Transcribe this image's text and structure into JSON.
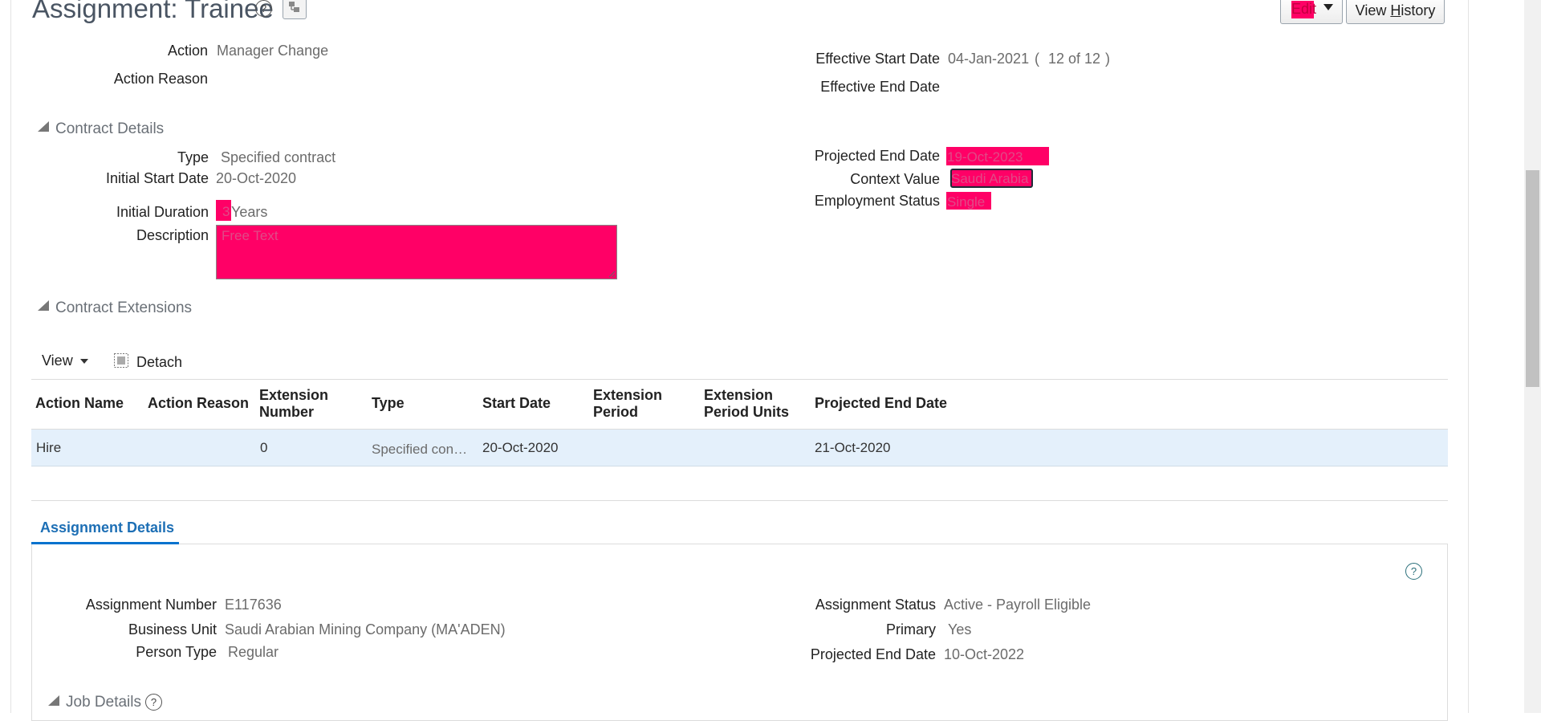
{
  "page": {
    "title": "Assignment: Trainee",
    "help_glyph": "?",
    "edit_label": "Edit",
    "view_history_prefix": "View ",
    "view_history_underlined": "H",
    "view_history_suffix": "istory"
  },
  "summary": {
    "action_label": "Action",
    "action_value": "Manager Change",
    "action_reason_label": "Action Reason",
    "action_reason_value": "",
    "effective_start_label": "Effective Start Date",
    "effective_start_value": "04-Jan-2021",
    "record_open": "(",
    "record_position": "12 of 12",
    "record_close": ")",
    "effective_end_label": "Effective End Date",
    "effective_end_value": ""
  },
  "contract_details": {
    "section_title": "Contract Details",
    "type_label": "Type",
    "type_value": "Specified contract",
    "initial_start_label": "Initial Start Date",
    "initial_start_value": "20-Oct-2020",
    "initial_duration_label": "Initial Duration",
    "initial_duration_value": "3",
    "initial_duration_unit": "Years",
    "description_label": "Description",
    "description_placeholder": "Free Text",
    "projected_end_label": "Projected End Date",
    "projected_end_value": "19-Oct-2023",
    "context_value_label": "Context Value",
    "context_value_value": "Saudi Arabia",
    "employment_status_label": "Employment Status",
    "employment_status_value": "Single"
  },
  "contract_extensions": {
    "section_title": "Contract Extensions",
    "view_label": "View",
    "detach_label": "Detach",
    "columns": {
      "action_name": "Action Name",
      "action_reason": "Action Reason",
      "ext_number_1": "Extension",
      "ext_number_2": "Number",
      "type": "Type",
      "start_date": "Start Date",
      "ext_period_1": "Extension",
      "ext_period_2": "Period",
      "ext_units_1": "Extension",
      "ext_units_2": "Period Units",
      "projected_end": "Projected End Date"
    },
    "rows": [
      {
        "action_name": "Hire",
        "action_reason": "",
        "extension_number": "0",
        "type": "Specified con…",
        "start_date": "20-Oct-2020",
        "extension_period": "",
        "extension_period_units": "",
        "projected_end_date": "21-Oct-2020"
      }
    ]
  },
  "assignment_details": {
    "tab_label": "Assignment Details",
    "assignment_number_label": "Assignment Number",
    "assignment_number_value": "E117636",
    "business_unit_label": "Business Unit",
    "business_unit_value": "Saudi Arabian Mining Company (MA'ADEN)",
    "person_type_label": "Person Type",
    "person_type_value": "Regular",
    "assignment_status_label": "Assignment Status",
    "assignment_status_value": "Active - Payroll Eligible",
    "primary_label": "Primary",
    "primary_value": "Yes",
    "projected_end_label": "Projected End Date",
    "projected_end_value": "10-Oct-2022"
  },
  "job_details": {
    "section_title": "Job Details"
  },
  "colors": {
    "highlight": "#ff0066",
    "selected_row": "#e4f0fb",
    "tab_accent": "#0572ce"
  }
}
